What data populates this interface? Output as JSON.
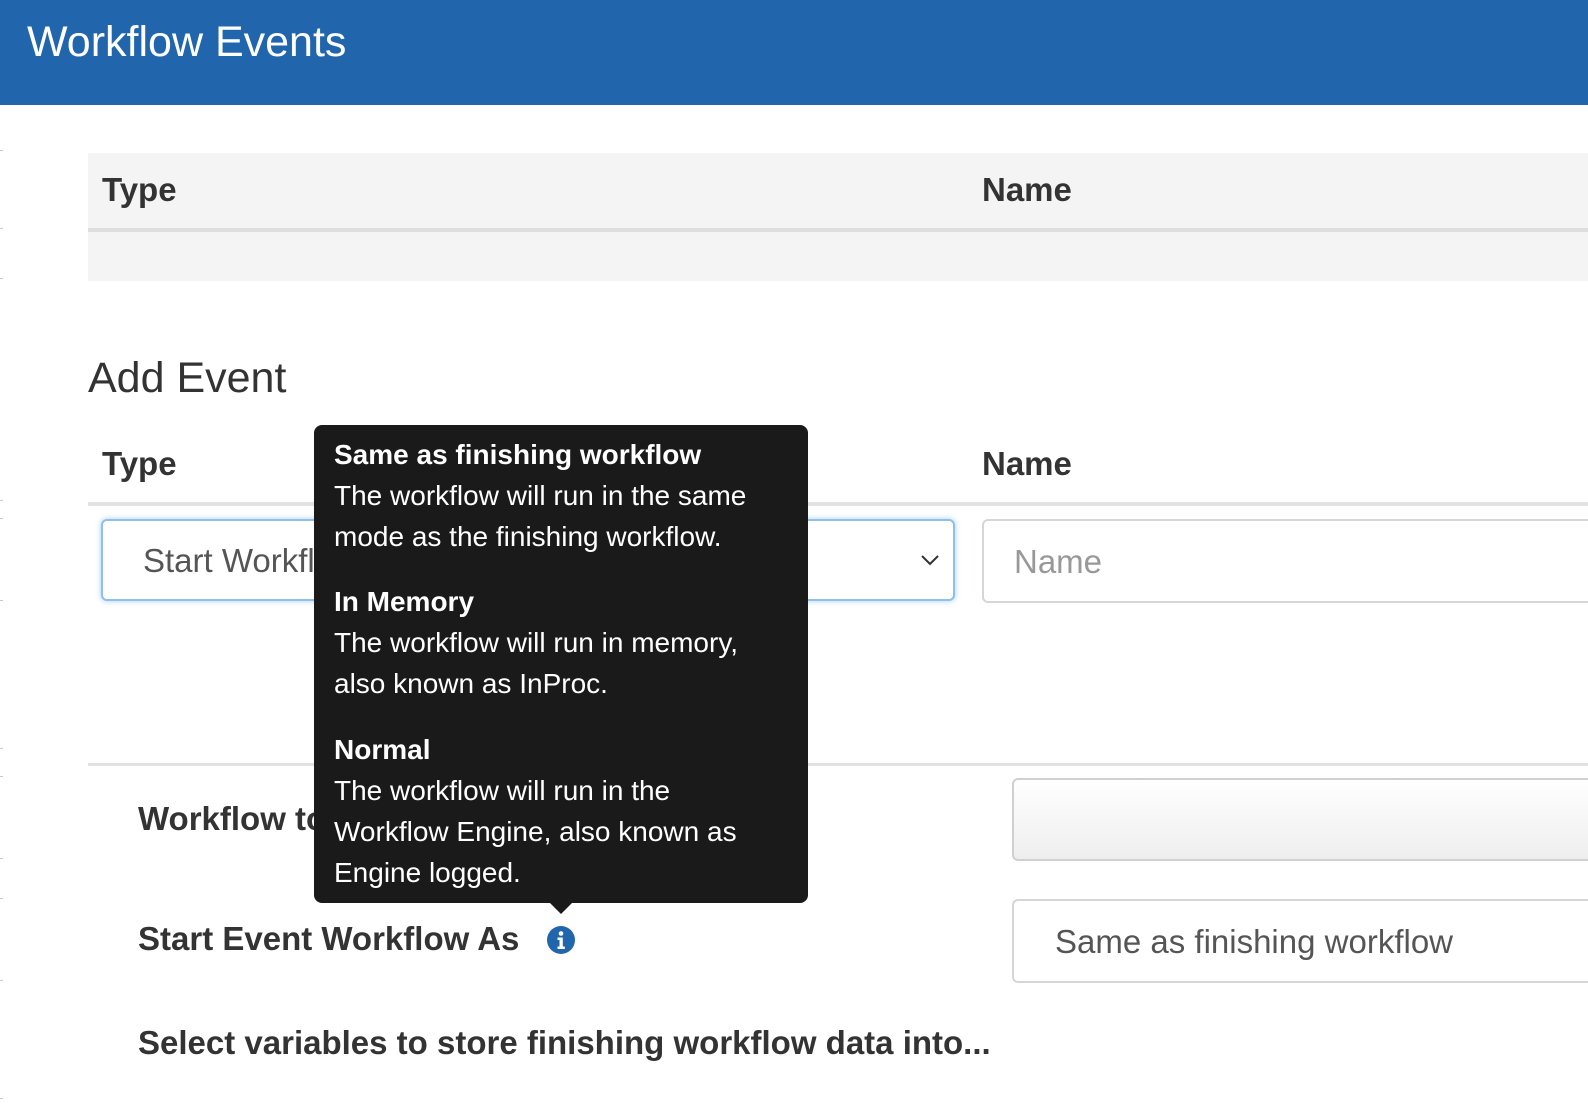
{
  "header": {
    "title": "Workflow Events"
  },
  "events_table": {
    "columns": [
      "Type",
      "Name"
    ],
    "rows": []
  },
  "add_event": {
    "title": "Add Event",
    "columns": [
      "Type",
      "Name"
    ],
    "type_select": {
      "value": "Start Workflow"
    },
    "name_input": {
      "placeholder": "Name",
      "value": ""
    }
  },
  "workflow_to_start": {
    "label": "Workflow to Start",
    "value": ""
  },
  "start_mode": {
    "label": "Start Event Workflow As",
    "info_icon": "info-icon",
    "value": "Same as finishing workflow"
  },
  "variables_section": {
    "label": "Select variables to store finishing workflow data into..."
  },
  "tooltip": {
    "options": [
      {
        "title": "Same as finishing workflow",
        "description": "The workflow will run in the same mode as the finishing workflow."
      },
      {
        "title": "In Memory",
        "description": "The workflow will run in memory, also known as InProc."
      },
      {
        "title": "Normal",
        "description": "The workflow will run in the Workflow Engine, also known as Engine logged."
      }
    ]
  },
  "colors": {
    "header_bg": "#2166ac",
    "tooltip_bg": "#1a1a1a",
    "info_icon": "#2166ac",
    "focus_border": "#8fc0e9"
  }
}
